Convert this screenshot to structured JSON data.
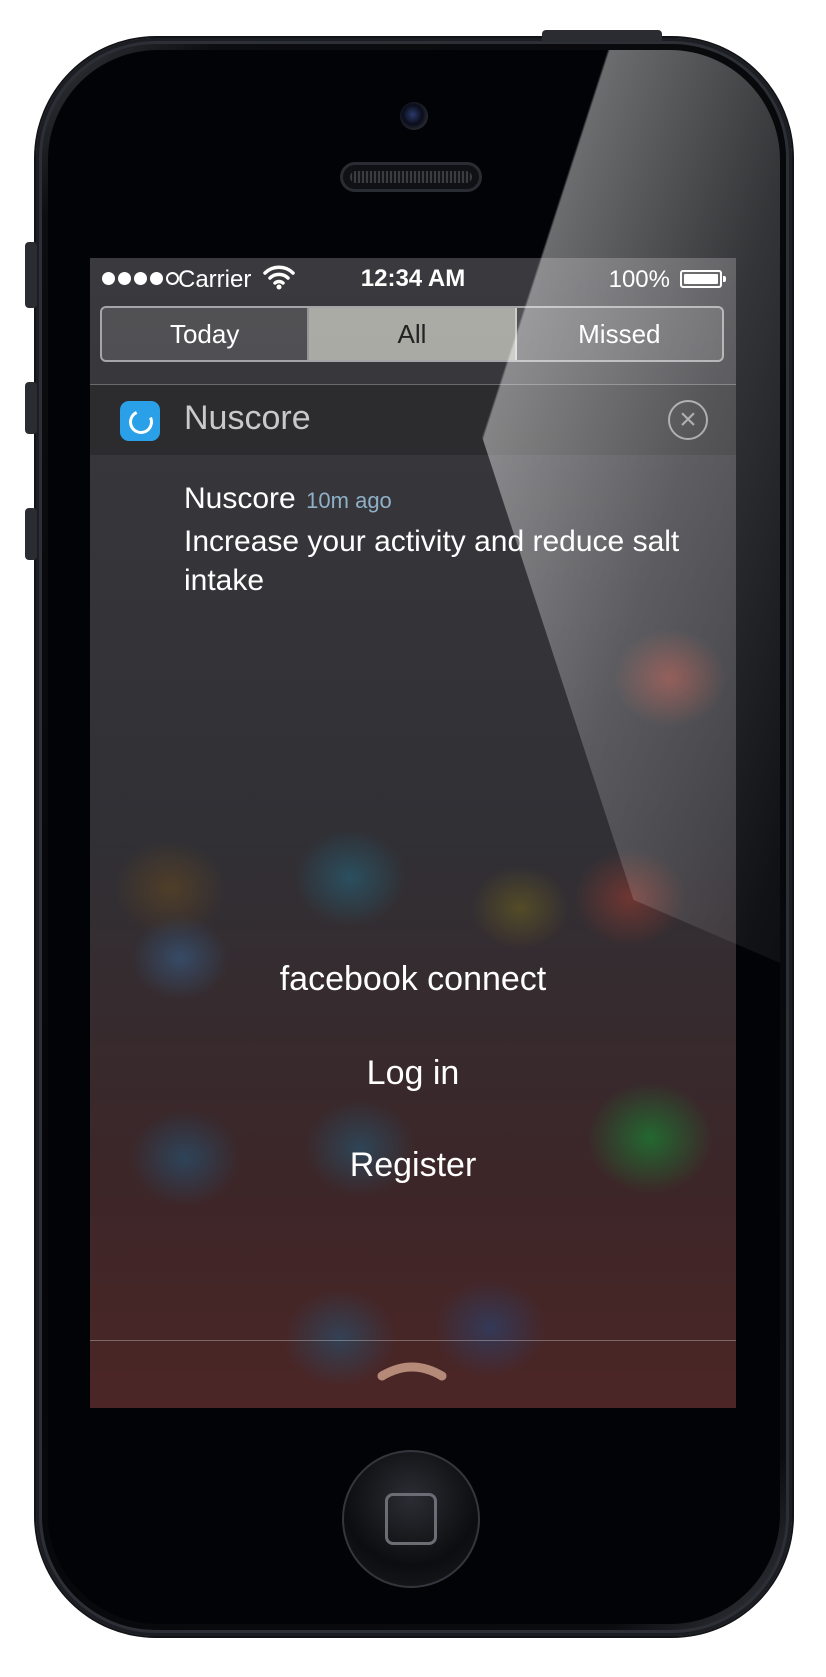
{
  "status_bar": {
    "carrier": "Carrier",
    "time": "12:34 AM",
    "battery_percent": "100%",
    "signal_bars_filled": 4,
    "signal_bars_total": 5
  },
  "notification_center": {
    "tabs": [
      {
        "label": "Today",
        "active": false
      },
      {
        "label": "All",
        "active": true
      },
      {
        "label": "Missed",
        "active": false
      }
    ],
    "app_group": {
      "app_name": "Nuscore",
      "icon": "nuscore-app-icon",
      "icon_color": "#2aa0e8"
    },
    "notification": {
      "title": "Nuscore",
      "time_ago": "10m ago",
      "body": "Increase your activity and reduce salt intake"
    }
  },
  "app_actions": {
    "facebook_connect": "facebook connect",
    "log_in": "Log in",
    "register": "Register"
  }
}
